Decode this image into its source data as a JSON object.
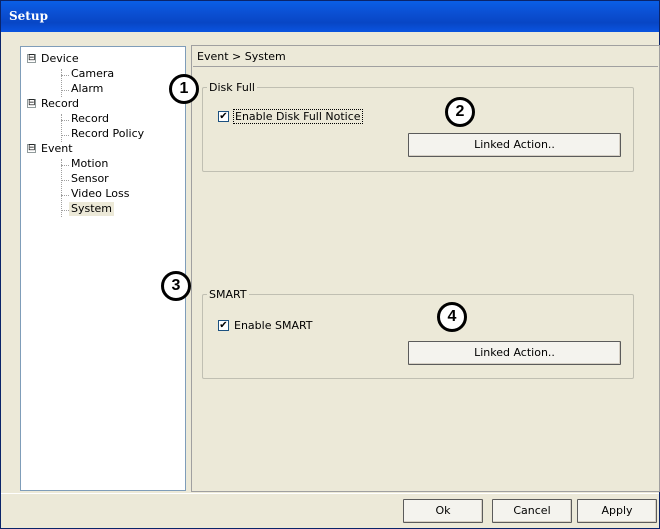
{
  "window": {
    "title": "Setup"
  },
  "tree": {
    "groups": [
      {
        "label": "Device",
        "expander": "⊟",
        "children": [
          "Camera",
          "Alarm"
        ]
      },
      {
        "label": "Record",
        "expander": "⊟",
        "children": [
          "Record",
          "Record Policy"
        ]
      },
      {
        "label": "Event",
        "expander": "⊟",
        "children": [
          "Motion",
          "Sensor",
          "Video Loss",
          "System"
        ]
      }
    ],
    "selected": "System"
  },
  "breadcrumb": "Event > System",
  "disk_full": {
    "legend": "Disk Full",
    "checkbox_label": "Enable Disk Full Notice",
    "checked": true,
    "button_label": "Linked Action.."
  },
  "smart": {
    "legend": "SMART",
    "checkbox_label": "Enable SMART",
    "checked": true,
    "button_label": "Linked Action.."
  },
  "badges": [
    "1",
    "2",
    "3",
    "4"
  ],
  "footer": {
    "ok": "Ok",
    "cancel": "Cancel",
    "apply": "Apply"
  },
  "checkmark": "✔"
}
